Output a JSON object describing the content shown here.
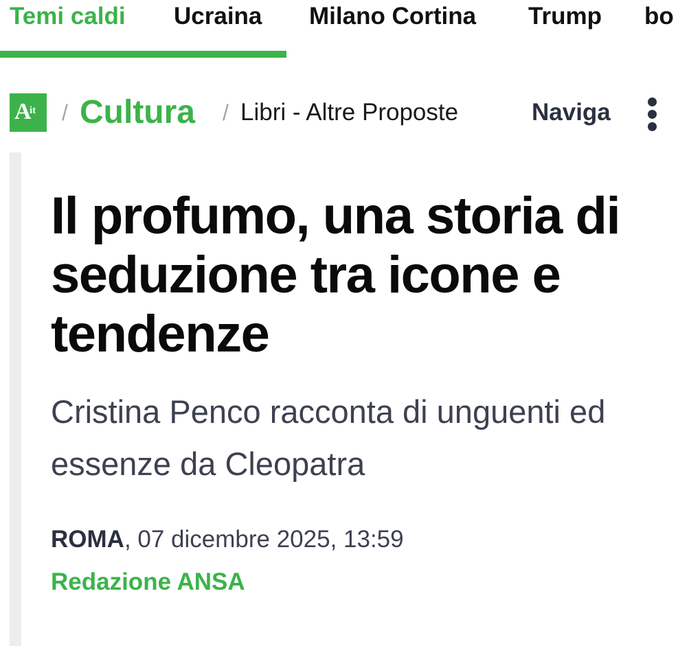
{
  "hot_topics": {
    "items": [
      {
        "label": "Temi caldi",
        "active": true
      },
      {
        "label": "Ucraina",
        "active": false
      },
      {
        "label": "Milano Cortina",
        "active": false
      },
      {
        "label": "Trump",
        "active": false
      },
      {
        "label": "bo",
        "active": false
      }
    ]
  },
  "breadcrumb": {
    "logo_letter": "A",
    "logo_suffix": "it",
    "separator": "/",
    "section": "Cultura",
    "subsection": "Libri - Altre Proposte"
  },
  "nav": {
    "label": "Naviga",
    "menu_icon": "more-vertical-icon"
  },
  "article": {
    "headline": "Il profumo, una storia di seduzione tra icone e tendenze",
    "subheadline": "Cristina Penco racconta di unguenti ed essenze da Cleopatra",
    "place": "ROMA",
    "date": ", 07 dicembre 2025, 13:59",
    "author": "Redazione ANSA"
  },
  "colors": {
    "accent_green": "#3bb34a",
    "text_dark": "#0a0a0a",
    "text_slate": "#3d4150",
    "separator_gray": "#a6a6a6"
  }
}
